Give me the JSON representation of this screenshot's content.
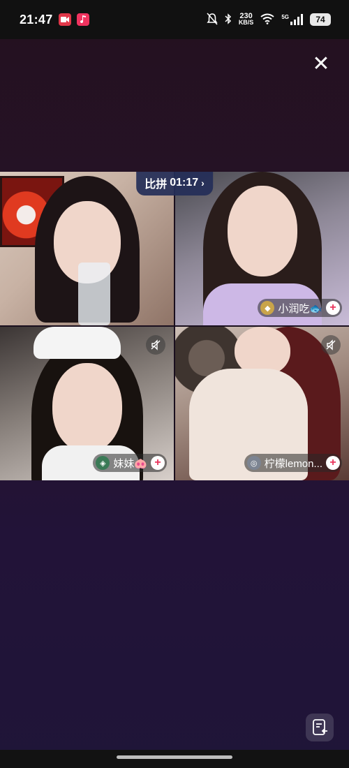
{
  "status_bar": {
    "time": "21:47",
    "notification_icons": [
      "video-app-icon",
      "music-app-icon"
    ],
    "network_speed": "230",
    "network_speed_unit": "KB/S",
    "network_type": "5G",
    "battery": "74"
  },
  "pk_battle": {
    "label": "比拼",
    "timer": "01:17",
    "chevron": "›"
  },
  "participants": [
    {
      "name": "",
      "level_icon": "none",
      "muted": false
    },
    {
      "name": "小润吃🐟",
      "level_icon": "gold-badge",
      "muted": false
    },
    {
      "name": "妹妹🐽",
      "level_icon": "green-badge",
      "muted": true
    },
    {
      "name": "柠檬lemon...",
      "level_icon": "gray-badge",
      "muted": true
    }
  ],
  "follow_symbol": "+",
  "close_symbol": "✕",
  "colors": {
    "background_top": "#24111f",
    "background_bottom": "#1f1538",
    "badge_bg": "#242e58",
    "follow_accent": "#e8335a"
  }
}
